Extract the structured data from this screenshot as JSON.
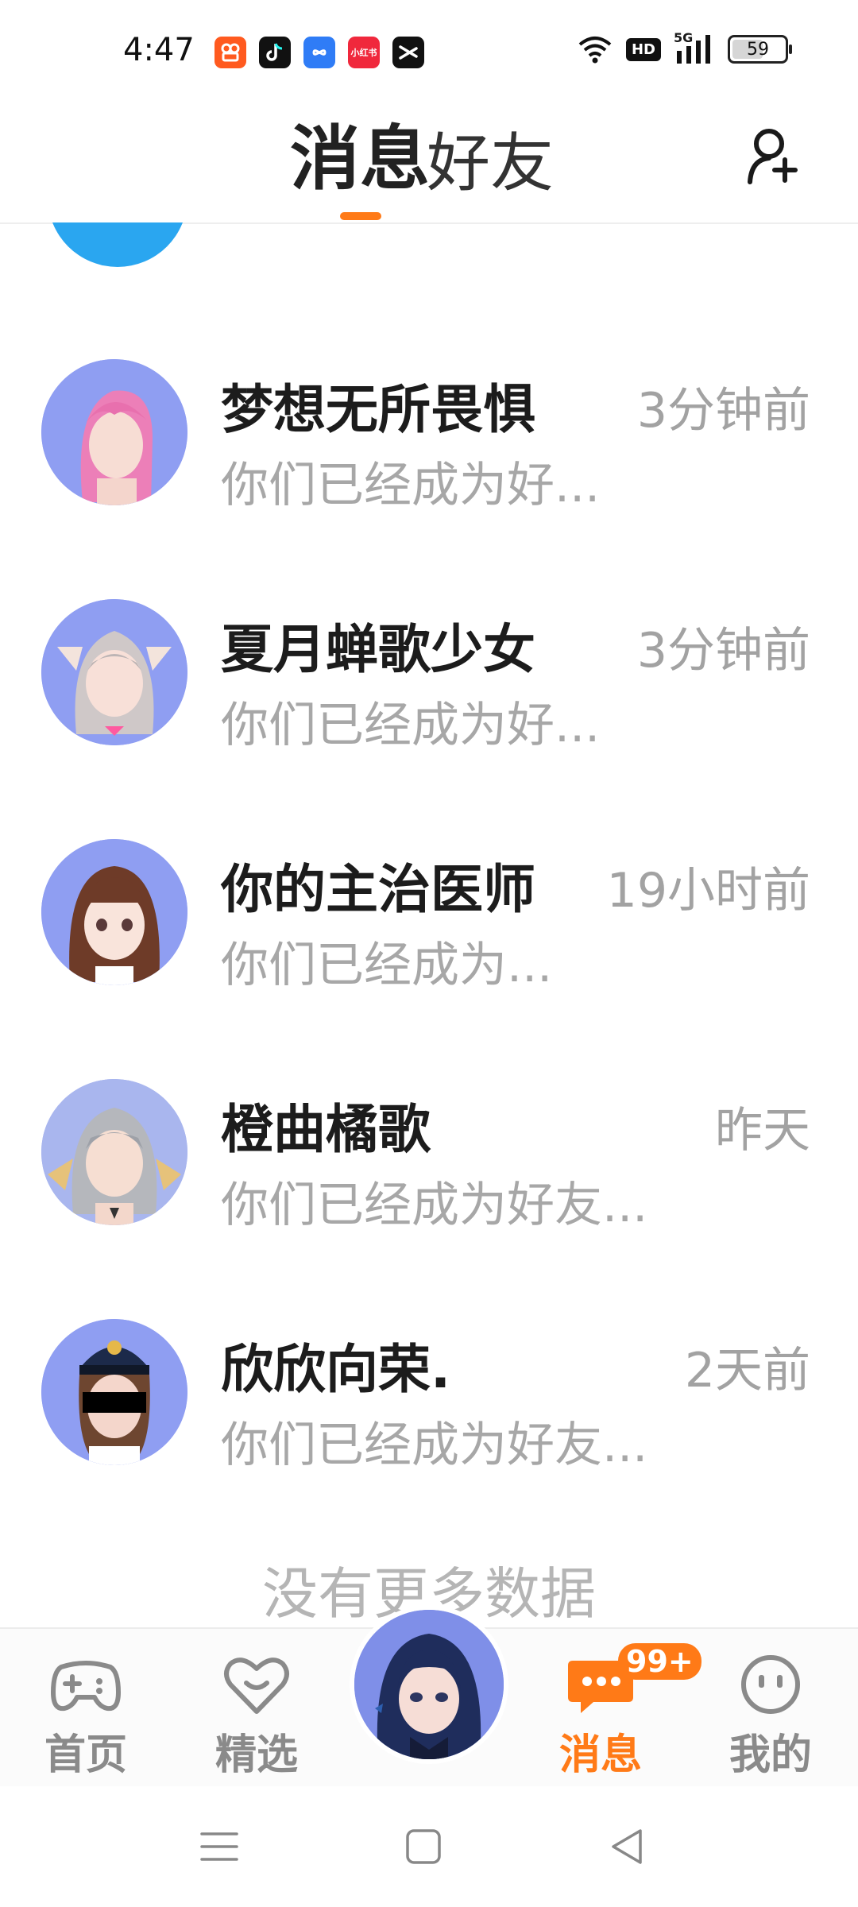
{
  "status_bar": {
    "time": "4:47",
    "apps": [
      {
        "icon": "kuaishou-icon",
        "color": "#ff5a1f",
        "label": ""
      },
      {
        "icon": "tiktok-icon",
        "color": "#111111",
        "label": ""
      },
      {
        "icon": "infinity-icon",
        "color": "#2f7cf6",
        "label": ""
      },
      {
        "icon": "xiaohongshu-icon",
        "color": "#f0283c",
        "label": "小红书"
      },
      {
        "icon": "capcut-icon",
        "color": "#111111",
        "label": ""
      }
    ],
    "hd": "HD",
    "network": "5G",
    "battery": "59",
    "battery_level": 0.59
  },
  "header": {
    "tab_messages": "消息",
    "tab_friends": "好友"
  },
  "accent": "#ff7a17",
  "conversations": [
    {
      "name": "梦想无所畏惧",
      "time": "3分钟前",
      "preview": "你们已经成为好..."
    },
    {
      "name": "夏月蝉歌少女",
      "time": "3分钟前",
      "preview": "你们已经成为好..."
    },
    {
      "name": "你的主治医师",
      "time": "19小时前",
      "preview": "你们已经成为..."
    },
    {
      "name": "橙曲橘歌",
      "time": "昨天",
      "preview": "你们已经成为好友..."
    },
    {
      "name": "欣欣向荣.",
      "time": "2天前",
      "preview": "你们已经成为好友..."
    }
  ],
  "no_more": "没有更多数据",
  "bottom_nav": {
    "home": "首页",
    "featured": "精选",
    "messages": "消息",
    "mine": "我的",
    "badge": "99+"
  }
}
